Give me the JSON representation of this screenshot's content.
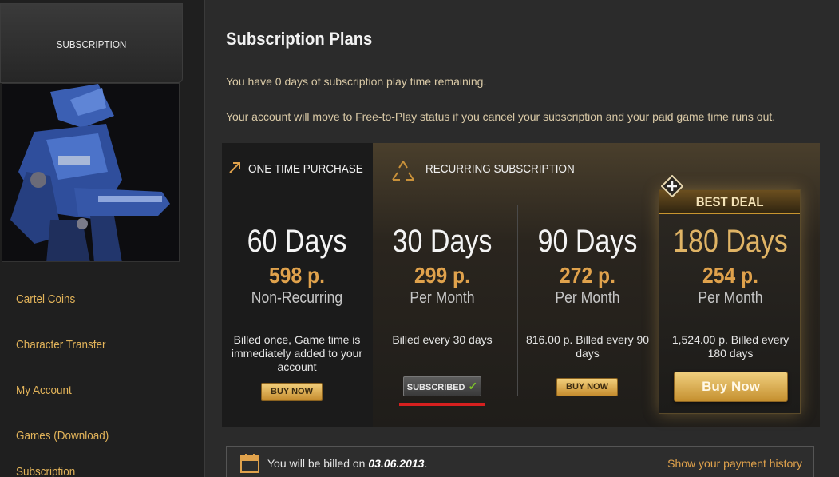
{
  "sidebar": {
    "tab_label": "SUBSCRIPTION",
    "items": [
      {
        "label": "Cartel Coins"
      },
      {
        "label": "Character Transfer"
      },
      {
        "label": "My Account"
      },
      {
        "label": "Games (Download)"
      },
      {
        "label": "Subscription"
      }
    ]
  },
  "main": {
    "title": "Subscription Plans",
    "remaining_text": "You have 0 days of subscription play time remaining.",
    "f2p_text": "Your account will move to Free-to-Play status if you cancel your subscription and your paid game time runs out."
  },
  "plans": {
    "one_time_header": "ONE TIME PURCHASE",
    "recurring_header": "RECURRING SUBSCRIPTION",
    "best_deal_label": "BEST DEAL",
    "items": [
      {
        "days": "60 Days",
        "price": "598 p.",
        "period": "Non-Recurring",
        "desc": "Billed once, Game time is immediately added to your account",
        "button": "BUY NOW"
      },
      {
        "days": "30 Days",
        "price": "299 p.",
        "period": "Per Month",
        "desc": "Billed every 30 days",
        "button": "SUBSCRIBED"
      },
      {
        "days": "90 Days",
        "price": "272 p.",
        "period": "Per Month",
        "desc": "816.00 p. Billed every 90 days",
        "button": "BUY NOW"
      },
      {
        "days": "180 Days",
        "price": "254 p.",
        "period": "Per Month",
        "desc": "1,524.00 p. Billed every 180 days",
        "button": "Buy Now"
      }
    ]
  },
  "billing": {
    "prefix": "You will be billed on",
    "date": "03.06.2013",
    "suffix": ".",
    "history_link": "Show your payment history"
  },
  "colors": {
    "accent": "#e0a24c",
    "nav": "#e3b45a",
    "subscribed_check": "#7dc22a",
    "highlight": "#d6201f"
  },
  "icons": {
    "one_time": "arrow-up-right-icon",
    "recurring": "recycle-icon",
    "best": "plus-badge-icon",
    "calendar": "calendar-icon",
    "check": "checkmark-icon"
  }
}
